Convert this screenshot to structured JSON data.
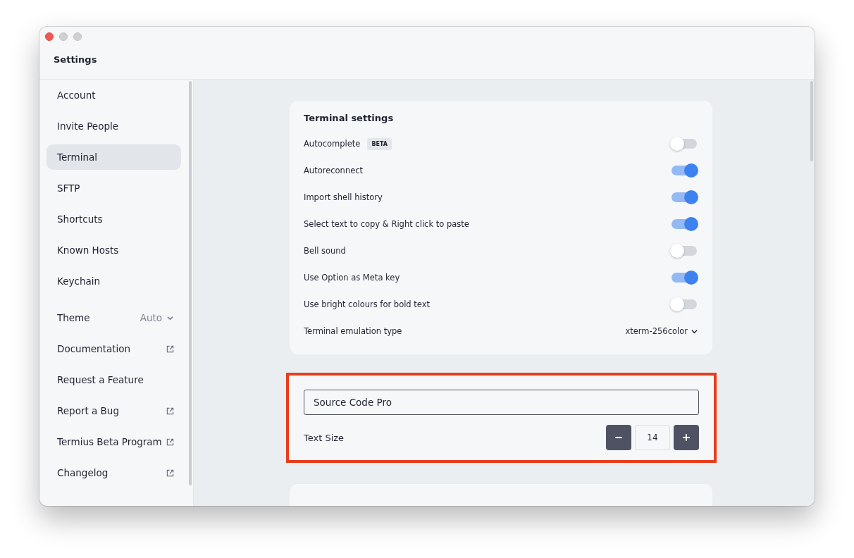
{
  "window": {
    "title": "Settings"
  },
  "sidebar": {
    "items": [
      {
        "label": "Account",
        "kind": "nav",
        "selected": false
      },
      {
        "label": "Invite People",
        "kind": "nav",
        "selected": false
      },
      {
        "label": "Terminal",
        "kind": "nav",
        "selected": true
      },
      {
        "label": "SFTP",
        "kind": "nav",
        "selected": false
      },
      {
        "label": "Shortcuts",
        "kind": "nav",
        "selected": false
      },
      {
        "label": "Known Hosts",
        "kind": "nav",
        "selected": false
      },
      {
        "label": "Keychain",
        "kind": "nav",
        "selected": false
      },
      {
        "label": "Theme",
        "kind": "select",
        "value": "Auto",
        "selected": false
      },
      {
        "label": "Documentation",
        "kind": "external",
        "selected": false
      },
      {
        "label": "Request a Feature",
        "kind": "nav",
        "selected": false
      },
      {
        "label": "Report a Bug",
        "kind": "external",
        "selected": false
      },
      {
        "label": "Termius Beta Program",
        "kind": "external",
        "selected": false
      },
      {
        "label": "Changelog",
        "kind": "external",
        "selected": false
      }
    ]
  },
  "terminal_settings": {
    "title": "Terminal settings",
    "rows": [
      {
        "label": "Autocomplete",
        "kind": "toggle",
        "badge": "BETA",
        "on": false
      },
      {
        "label": "Autoreconnect",
        "kind": "toggle",
        "on": true
      },
      {
        "label": "Import shell history",
        "kind": "toggle",
        "on": true
      },
      {
        "label": "Select text to copy & Right click to paste",
        "kind": "toggle",
        "on": true
      },
      {
        "label": "Bell sound",
        "kind": "toggle",
        "on": false
      },
      {
        "label": "Use Option as Meta key",
        "kind": "toggle",
        "on": true
      },
      {
        "label": "Use bright colours for bold text",
        "kind": "toggle",
        "on": false
      },
      {
        "label": "Terminal emulation type",
        "kind": "select",
        "value": "xterm-256color"
      }
    ]
  },
  "font_settings": {
    "highlighted": true,
    "font": "Source Code Pro",
    "text_size_label": "Text Size",
    "text_size": "14"
  }
}
